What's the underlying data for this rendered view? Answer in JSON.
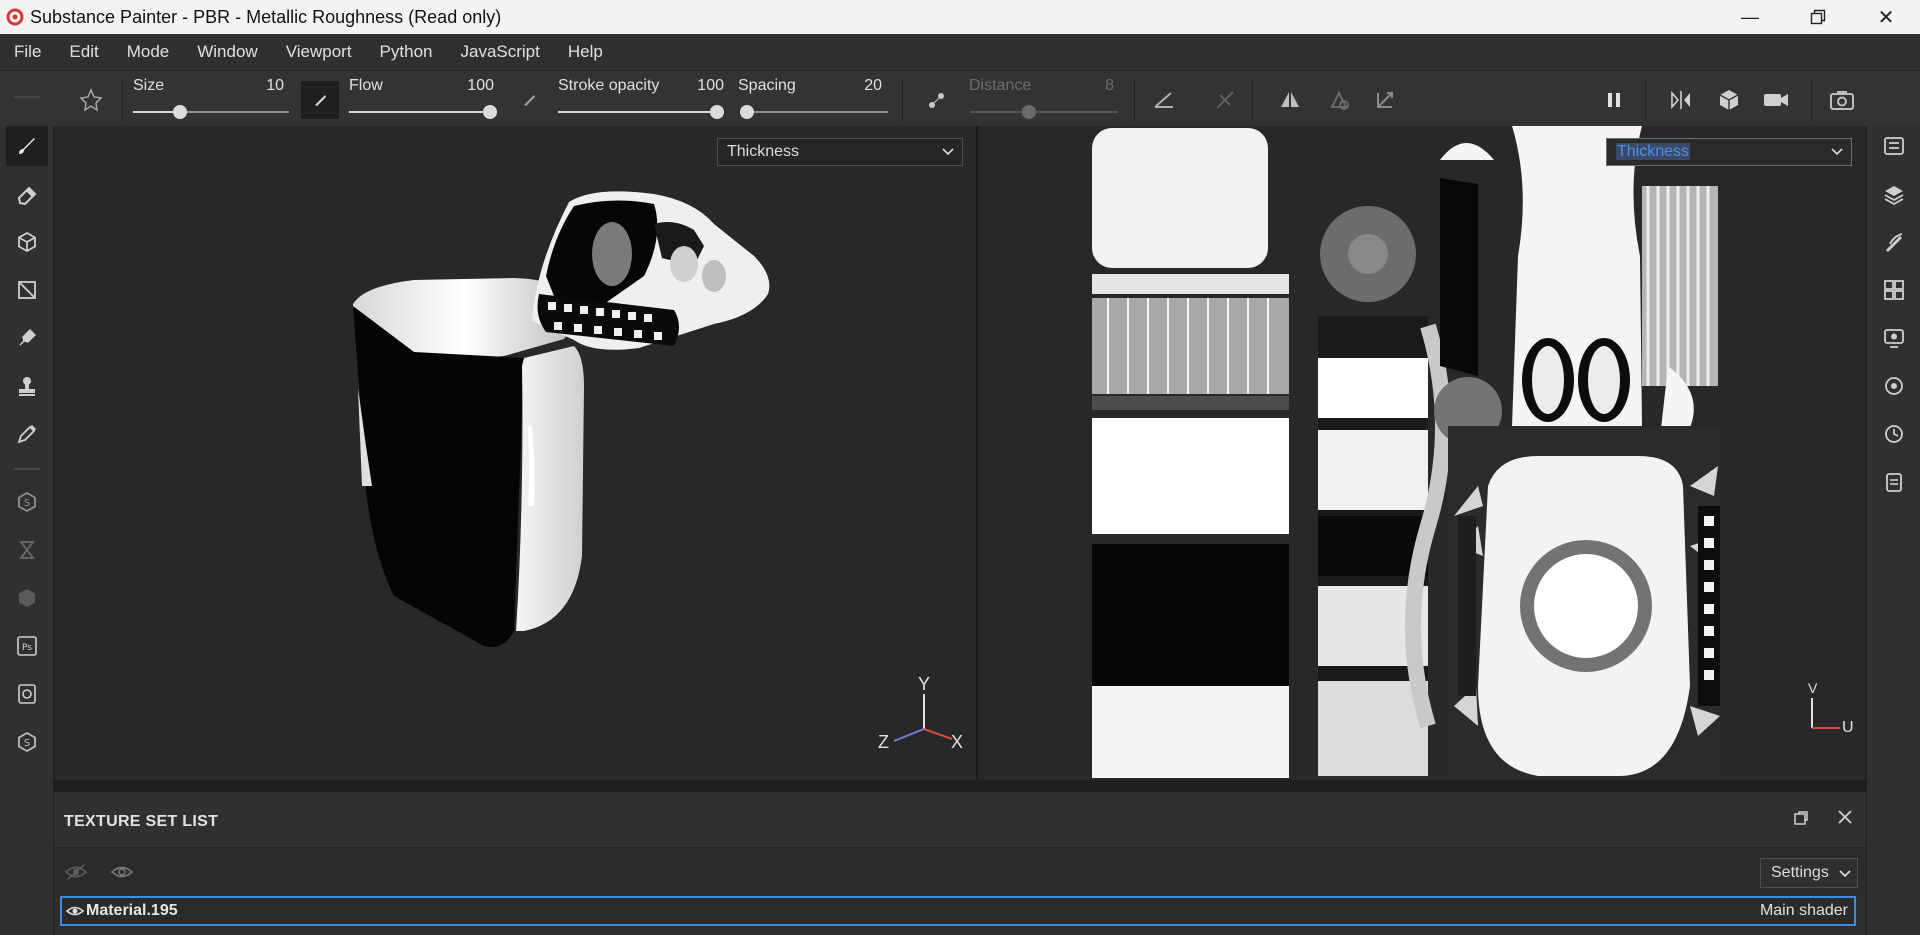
{
  "window": {
    "title": "Substance Painter - PBR - Metallic Roughness (Read only)",
    "minimize_glyph": "—",
    "maximize_icon": "restore-icon",
    "close_glyph": "✕"
  },
  "menu": {
    "items": [
      "File",
      "Edit",
      "Mode",
      "Window",
      "Viewport",
      "Python",
      "JavaScript",
      "Help"
    ]
  },
  "toolbar": {
    "size": {
      "label": "Size",
      "value": "10",
      "level": 0.3
    },
    "flow": {
      "label": "Flow",
      "value": "100",
      "level": 1.0
    },
    "stroke_opacity": {
      "label": "Stroke opacity",
      "value": "100",
      "level": 1.0
    },
    "spacing": {
      "label": "Spacing",
      "value": "20",
      "level": 0.05
    },
    "distance": {
      "label": "Distance",
      "value": "8",
      "level": 0.4
    }
  },
  "viewport3d": {
    "channel": "Thickness",
    "axes": {
      "y": "Y",
      "z": "Z",
      "x": "X"
    }
  },
  "viewport2d": {
    "channel": "Thickness",
    "axes": {
      "v": "V",
      "u": "U"
    }
  },
  "texture_set_list": {
    "title": "TEXTURE SET LIST",
    "settings_label": "Settings",
    "material": {
      "name": "Material.195",
      "shader": "Main shader"
    }
  },
  "colors": {
    "accent": "#3d8ce0",
    "axis_x": "#d64a4a",
    "axis_y": "#e0e0e0",
    "axis_z": "#6f7fe0"
  }
}
